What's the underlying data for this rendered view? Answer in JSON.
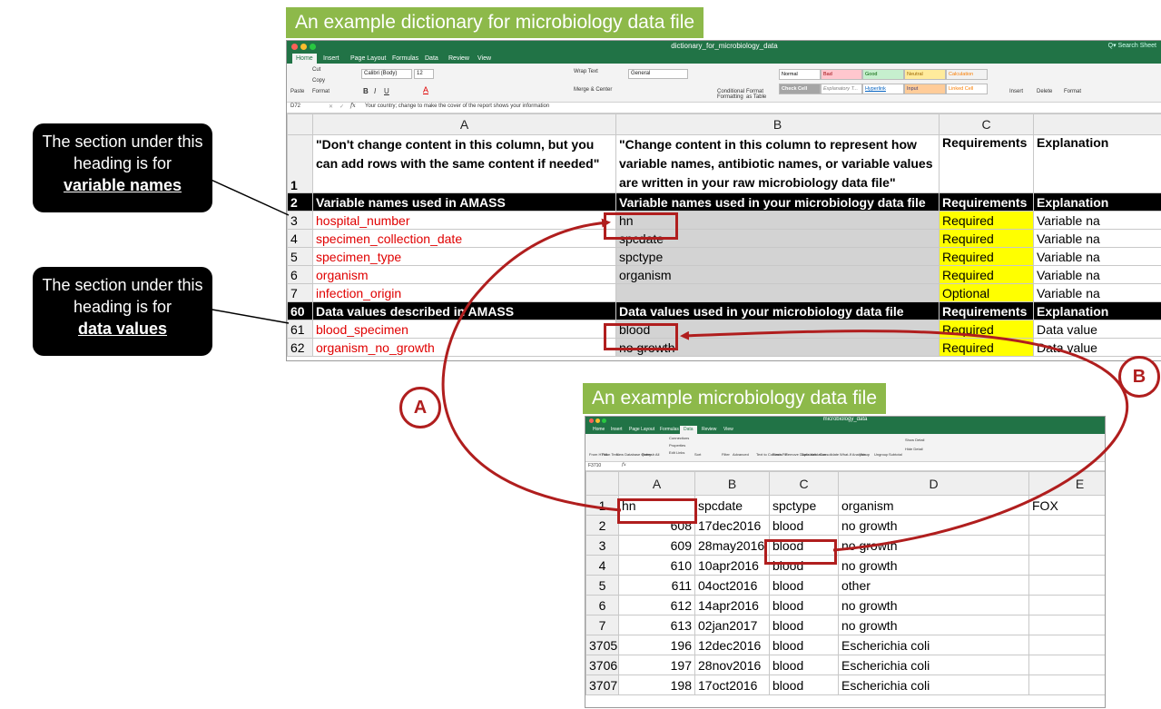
{
  "top": {
    "caption": "An example dictionary for microbiology data file",
    "window_title": "dictionary_for_microbiology_data",
    "search": "Q▾ Search Sheet",
    "tabs": [
      "Home",
      "Insert",
      "Page Layout",
      "Formulas",
      "Data",
      "Review",
      "View"
    ],
    "ribbon": {
      "paste": "Paste",
      "cut": "Cut",
      "copy": "Copy",
      "format": "Format",
      "font": "Calibri (Body)",
      "size": "12",
      "wrap": "Wrap Text",
      "merge": "Merge & Center",
      "number_format": "General",
      "cond": "Conditional Formatting",
      "format_table": "Format as Table",
      "styles": [
        "Normal",
        "Bad",
        "Good",
        "Neutral",
        "Calculation",
        "Check Cell",
        "Explanatory T...",
        "Hyperlink",
        "Input",
        "Linked Cell"
      ],
      "insert": "Insert",
      "delete": "Delete",
      "format2": "Format"
    },
    "name_box": "D72",
    "formula": "Your country; change to make the cover of the report shows your information",
    "col_headers": [
      "A",
      "B",
      "C"
    ],
    "intro": {
      "a": "\"Don't change content in this column, but you can add rows with the same content if needed\"",
      "b": "\"Change content in this column to represent how variable names, antibiotic names, or variable values are written in your raw microbiology data file\"",
      "c": "Requirements",
      "d": "Explanation"
    },
    "rows": [
      {
        "n": "2",
        "a": "Variable names used in AMASS",
        "b": "Variable names used in your microbiology data file",
        "c": "Requirements",
        "d": "Explanation",
        "kind": "black"
      },
      {
        "n": "3",
        "a": "hospital_number",
        "b": "hn",
        "c": "Required",
        "d": "Variable na",
        "kind": "data"
      },
      {
        "n": "4",
        "a": "specimen_collection_date",
        "b": "spcdate",
        "c": "Required",
        "d": "Variable na",
        "kind": "data"
      },
      {
        "n": "5",
        "a": "specimen_type",
        "b": "spctype",
        "c": "Required",
        "d": "Variable na",
        "kind": "data"
      },
      {
        "n": "6",
        "a": "organism",
        "b": "organism",
        "c": "Required",
        "d": "Variable na",
        "kind": "data"
      },
      {
        "n": "7",
        "a": "infection_origin",
        "b": "",
        "c": "Optional",
        "d": "Variable na",
        "kind": "data"
      },
      {
        "n": "60",
        "a": "Data values described in AMASS",
        "b": "Data values used in your microbiology data file",
        "c": "Requirements",
        "d": "Explanation",
        "kind": "black"
      },
      {
        "n": "61",
        "a": "blood_specimen",
        "b": "blood",
        "c": "Required",
        "d": "Data value",
        "kind": "data"
      },
      {
        "n": "62",
        "a": "organism_no_growth",
        "b": "no growth",
        "c": "Required",
        "d": "Data value",
        "kind": "data"
      }
    ]
  },
  "callouts": {
    "var": {
      "line1": "The section under this",
      "line2": "heading is for",
      "line3": "variable names"
    },
    "data": {
      "line1": "The section under this",
      "line2": "heading is for",
      "line3": "data values"
    }
  },
  "markers": {
    "a": "A",
    "b": "B"
  },
  "bottom": {
    "caption": "An example microbiology data file",
    "window_title": "microbiology_data",
    "tabs": [
      "Home",
      "Insert",
      "Page Layout",
      "Formulas",
      "Data",
      "Review",
      "View"
    ],
    "ribbon": [
      "From HTML",
      "From Text",
      "New Database Query",
      "Refresh All",
      "Connections",
      "Properties",
      "Edit Links",
      "Sort",
      "Filter",
      "Advanced",
      "Text to Columns",
      "Flash Fill",
      "Remove Duplicates",
      "Data Validation",
      "Consolidate",
      "What-If Analysis",
      "Group",
      "Ungroup",
      "Subtotal",
      "Show Detail",
      "Hide Detail"
    ],
    "name_box": "F3710",
    "col_headers": [
      "A",
      "B",
      "C",
      "D",
      "E"
    ],
    "header_row": {
      "n": "1",
      "a": "hn",
      "b": "spcdate",
      "c": "spctype",
      "d": "organism",
      "e": "FOX"
    },
    "rows": [
      {
        "n": "2",
        "a": "608",
        "b": "17dec2016",
        "c": "blood",
        "d": "no growth"
      },
      {
        "n": "3",
        "a": "609",
        "b": "28may2016",
        "c": "blood",
        "d": "no growth"
      },
      {
        "n": "4",
        "a": "610",
        "b": "10apr2016",
        "c": "blood",
        "d": "no growth"
      },
      {
        "n": "5",
        "a": "611",
        "b": "04oct2016",
        "c": "blood",
        "d": "other"
      },
      {
        "n": "6",
        "a": "612",
        "b": "14apr2016",
        "c": "blood",
        "d": "no growth"
      },
      {
        "n": "7",
        "a": "613",
        "b": "02jan2017",
        "c": "blood",
        "d": "no growth"
      },
      {
        "n": "3705",
        "a": "196",
        "b": "12dec2016",
        "c": "blood",
        "d": "Escherichia coli"
      },
      {
        "n": "3706",
        "a": "197",
        "b": "28nov2016",
        "c": "blood",
        "d": "Escherichia coli"
      },
      {
        "n": "3707",
        "a": "198",
        "b": "17oct2016",
        "c": "blood",
        "d": "Escherichia coli"
      }
    ]
  }
}
